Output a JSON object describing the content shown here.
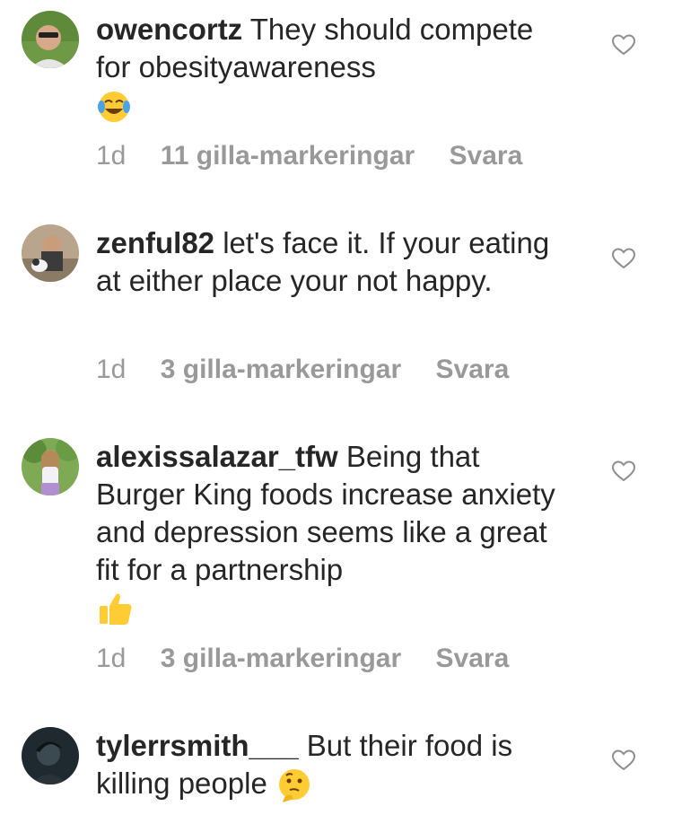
{
  "comments": [
    {
      "username": "owencortz",
      "text": "They should compete for obesityawareness",
      "emoji": "face-with-tears-of-joy-emoji",
      "time": "1d",
      "likes": "11 gilla-markeringar",
      "reply": "Svara"
    },
    {
      "username": "zenful82",
      "text": "let's face it. If your eating at either place your not happy.",
      "time": "1d",
      "likes": "3 gilla-markeringar",
      "reply": "Svara"
    },
    {
      "username": "alexissalazar_tfw",
      "text": "Being that Burger King foods increase anxiety and depression seems like a great fit for a partnership",
      "emoji": "thumbs-up-emoji",
      "time": "1d",
      "likes": "3 gilla-markeringar",
      "reply": "Svara"
    },
    {
      "username": "tylerrsmith___",
      "text": "But their food is killing people",
      "emoji": "thinking-face-emoji"
    }
  ],
  "colors": {
    "text": "#262626",
    "meta": "#999999",
    "emoji_yellow": "#FFCC33"
  }
}
